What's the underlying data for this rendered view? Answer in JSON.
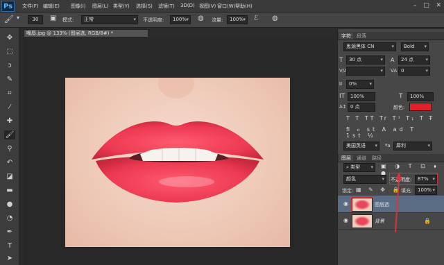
{
  "menubar": {
    "app_logo": "Ps",
    "items": [
      "文件(F)",
      "编辑(E)",
      "图像(I)",
      "图层(L)",
      "类型(Y)",
      "选择(S)",
      "滤镜(T)",
      "3D(D)",
      "视图(V)",
      "窗口(W)",
      "帮助(H)"
    ]
  },
  "options": {
    "brush_size": "30",
    "mode_label": "模式:",
    "mode_value": "正常",
    "opacity_label": "不透明度:",
    "opacity_value": "100%",
    "flow_label": "流量:",
    "flow_value": "100%"
  },
  "document": {
    "tab_title": "嘴唇.jpg @ 133% (图层选, RGB/8#) *"
  },
  "character_panel": {
    "tabs": [
      "字符",
      "段落"
    ],
    "font_family": "思源黑体 CN",
    "font_style": "Bold",
    "size": "30 点",
    "leading": "24 点",
    "kerning": "",
    "tracking": "0",
    "scale_pct": "0%",
    "vscale": "100%",
    "hscale": "100%",
    "baseline": "0 点",
    "color_label": "颜色:",
    "language": "美国英语",
    "aa": "犀利"
  },
  "layers_panel": {
    "tabs": [
      "图层",
      "通道",
      "路径"
    ],
    "filter_label": "类型",
    "blend_mode": "颜色",
    "opacity_label": "不透明度:",
    "opacity_value": "87%",
    "lock_label": "锁定:",
    "fill_label": "填充:",
    "fill_value": "100%",
    "layers": [
      {
        "name": "图层选",
        "selected": true
      },
      {
        "name": "背景",
        "selected": false
      }
    ]
  },
  "colors": {
    "text_color_swatch": "#e0202a",
    "annotation_red": "#d7353d"
  }
}
